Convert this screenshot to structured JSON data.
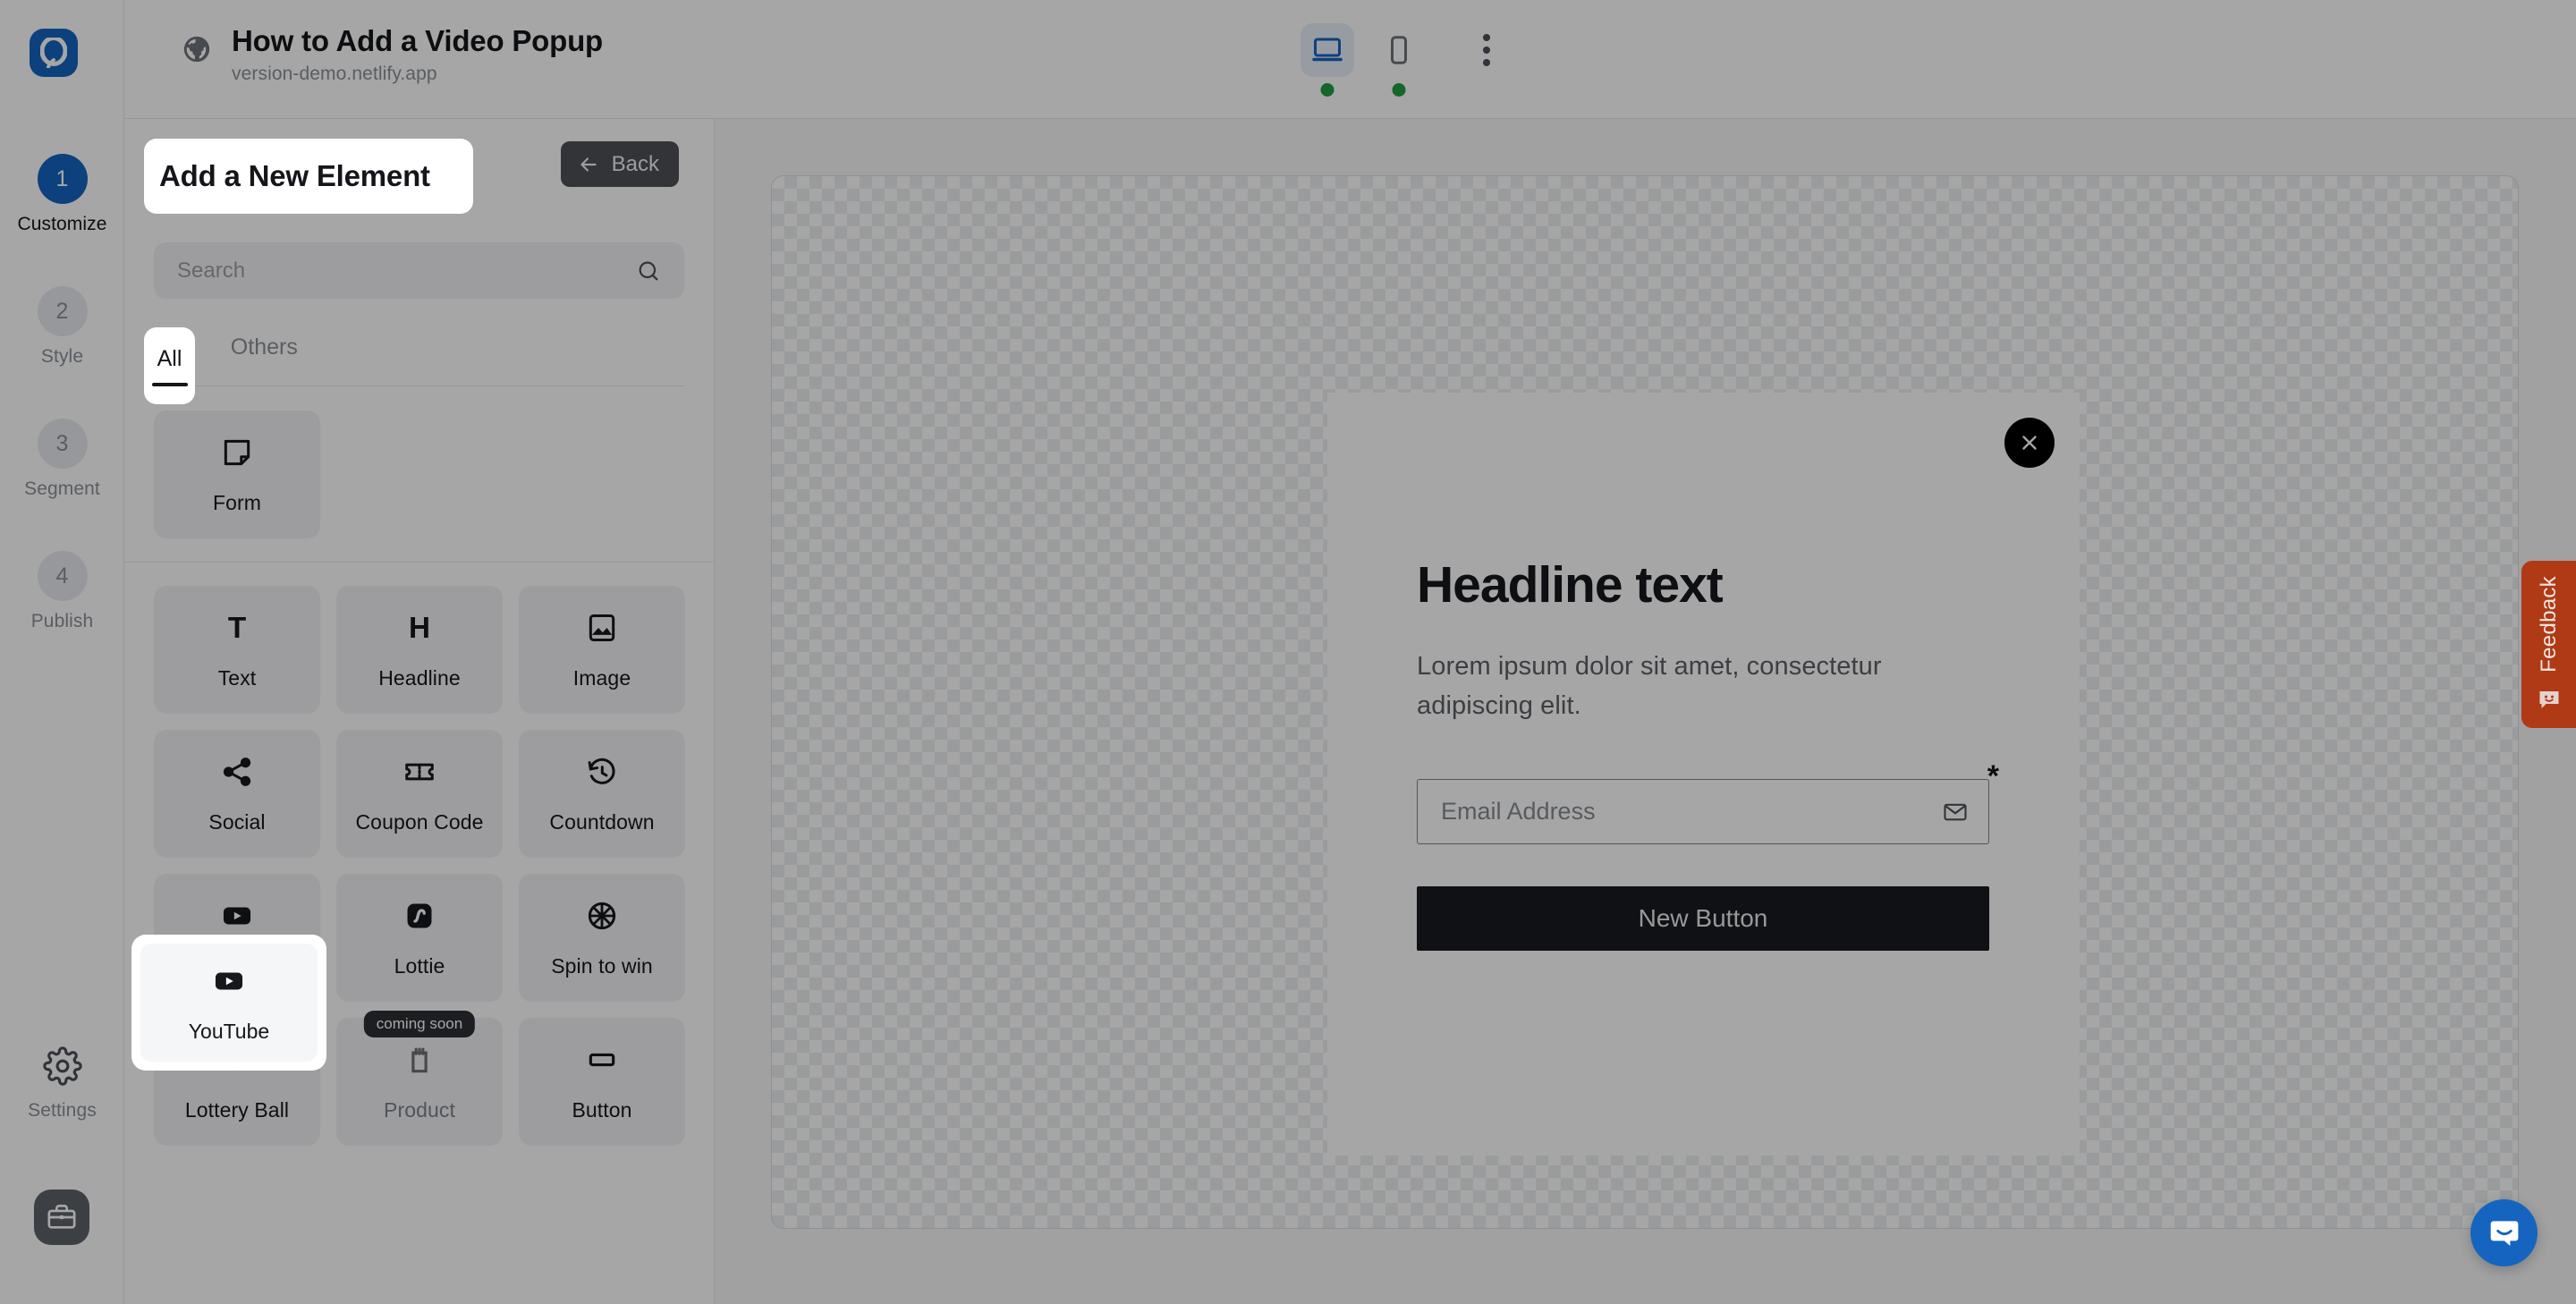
{
  "brand": {
    "logo_icon": "popupsmart-logo-icon",
    "accent_color": "#1565C0"
  },
  "topbar": {
    "globe_icon": "globe-icon",
    "project_title": "How to Add a Video Popup",
    "project_url": "version-demo.netlify.app",
    "devices": [
      {
        "id": "desktop",
        "icon": "desktop-monitor-icon",
        "active": true,
        "status_dot": "#1f9d3f"
      },
      {
        "id": "mobile",
        "icon": "mobile-phone-icon",
        "active": false,
        "status_dot": "#1f9d3f"
      }
    ],
    "more_icon": "kebab-menu-icon"
  },
  "rail": {
    "steps": [
      {
        "number": "1",
        "label": "Customize",
        "active": true
      },
      {
        "number": "2",
        "label": "Style",
        "active": false
      },
      {
        "number": "3",
        "label": "Segment",
        "active": false
      },
      {
        "number": "4",
        "label": "Publish",
        "active": false
      }
    ],
    "settings": {
      "icon": "gear-icon",
      "label": "Settings"
    },
    "workspace": {
      "icon": "briefcase-icon"
    }
  },
  "panel": {
    "title": "Add a New Element",
    "back_label": "Back",
    "back_icon": "arrow-left-icon",
    "search": {
      "placeholder": "Search",
      "value": "",
      "icon": "search-icon"
    },
    "tabs": [
      {
        "label": "All",
        "active": true
      },
      {
        "label": "Others",
        "active": false
      }
    ],
    "sections": [
      {
        "items": [
          {
            "label": "Form",
            "icon": "form-note-icon",
            "disabled": false,
            "badge": ""
          }
        ]
      },
      {
        "items": [
          {
            "label": "Text",
            "icon": "text-t-icon",
            "disabled": false,
            "badge": ""
          },
          {
            "label": "Headline",
            "icon": "headline-h-icon",
            "disabled": false,
            "badge": ""
          },
          {
            "label": "Image",
            "icon": "image-picture-icon",
            "disabled": false,
            "badge": ""
          },
          {
            "label": "Social",
            "icon": "share-social-icon",
            "disabled": false,
            "badge": ""
          },
          {
            "label": "Coupon Code",
            "icon": "ticket-coupon-icon",
            "disabled": false,
            "badge": ""
          },
          {
            "label": "Countdown",
            "icon": "clock-history-icon",
            "disabled": false,
            "badge": ""
          },
          {
            "label": "YouTube",
            "icon": "youtube-play-icon",
            "disabled": false,
            "badge": "",
            "highlighted": true
          },
          {
            "label": "Lottie",
            "icon": "lottie-icon",
            "disabled": false,
            "badge": ""
          },
          {
            "label": "Spin to win",
            "icon": "spin-wheel-icon",
            "disabled": false,
            "badge": ""
          },
          {
            "label": "Lottery Ball",
            "icon": "lottery-balls-icon",
            "disabled": false,
            "badge": ""
          },
          {
            "label": "Product",
            "icon": "product-tag-icon",
            "disabled": true,
            "badge": "coming soon"
          },
          {
            "label": "Button",
            "icon": "button-rect-icon",
            "disabled": false,
            "badge": ""
          }
        ]
      }
    ]
  },
  "popup": {
    "close_icon": "close-x-icon",
    "headline": "Headline text",
    "body": "Lorem ipsum dolor sit amet, consectetur adipiscing elit.",
    "email_placeholder": "Email Address",
    "email_value": "",
    "email_icon": "envelope-icon",
    "required_marker": "*",
    "cta_label": "New Button",
    "cta_color": "#191b1f"
  },
  "feedback": {
    "label": "Feedback",
    "icon": "smiley-chat-icon",
    "color": "#b03a16"
  },
  "chat": {
    "icon": "intercom-chat-icon",
    "color": "#1565C0"
  },
  "spotlight": {
    "title": "Add a New Element",
    "tab": "All",
    "cell_label": "YouTube",
    "cell_icon": "youtube-play-icon"
  }
}
